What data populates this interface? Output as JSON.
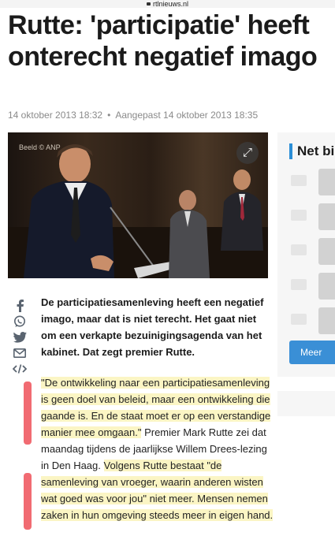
{
  "browser": {
    "url": "rtlnieuws.nl"
  },
  "article": {
    "title": "Rutte: 'participatie' heeft onterecht negatief imago",
    "published": "14 oktober 2013 18:32",
    "updated": "Aangepast 14 oktober 2013 18:35",
    "photo_credit": "Beeld © ANP",
    "lead": "De participatiesamenleving heeft een negatief imago, maar dat is niet terecht. Het gaat niet om een verkapte bezuinigingsagenda van het kabinet. Dat zegt premier Rutte.",
    "p1_hl": "\"De ontwikkeling naar een participatiesamenleving is geen doel van beleid, maar een ontwikkeling die gaande is. En de staat moet er op een verstandige manier mee omgaan.\"",
    "p1_rest": " Premier Mark Rutte zei dat maandag tijdens de jaarlijkse Willem Drees-lezing in Den Haag. ",
    "p2_hl": "Volgens Rutte bestaat \"de samenleving van vroeger, waarin anderen wisten wat goed was voor jou\" niet meer. Mensen nemen zaken in hun omgeving steeds meer in eigen hand."
  },
  "sidebar": {
    "title": "Net bi",
    "more_button": "Meer"
  },
  "share_icons": [
    "facebook-icon",
    "whatsapp-icon",
    "twitter-icon",
    "mail-icon",
    "embed-icon"
  ],
  "colors": {
    "accent": "#2b8ed6",
    "highlight": "#fbf5c4",
    "annotation": "#ef5b63"
  }
}
